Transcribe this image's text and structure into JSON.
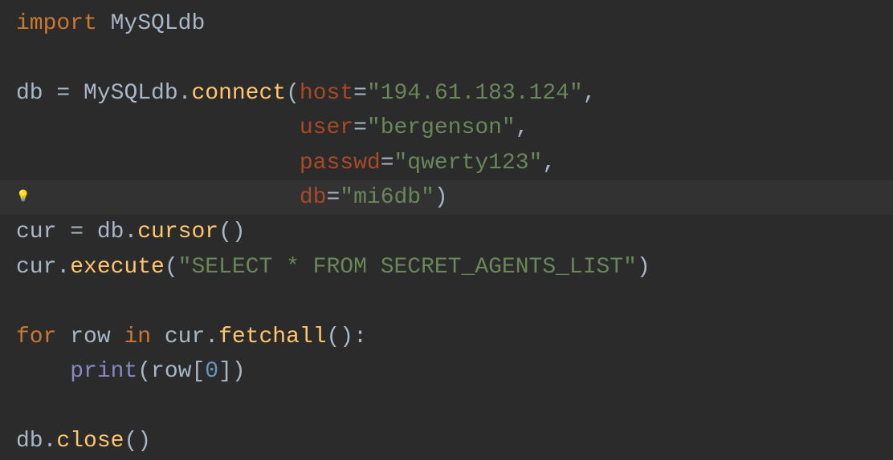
{
  "code": {
    "line1": {
      "import_kw": "import",
      "module": " MySQLdb"
    },
    "line3": {
      "var": "db ",
      "eq": "=",
      "module": " MySQLdb.",
      "method": "connect",
      "paren_open": "(",
      "param": "host",
      "param_eq": "=",
      "string": "\"194.61.183.124\"",
      "comma": ","
    },
    "line4": {
      "indent": "                     ",
      "param": "user",
      "param_eq": "=",
      "string": "\"bergenson\"",
      "comma": ","
    },
    "line5": {
      "indent": "                     ",
      "param": "passwd",
      "param_eq": "=",
      "string": "\"qwerty123\"",
      "comma": ","
    },
    "line6": {
      "indent": "                     ",
      "param": "db",
      "param_eq": "=",
      "string": "\"mi6db\"",
      "paren_close": ")"
    },
    "line7": {
      "var": "cur ",
      "eq": "=",
      "obj": " db.",
      "method": "cursor",
      "parens": "()"
    },
    "line8": {
      "obj": "cur.",
      "method": "execute",
      "paren_open": "(",
      "string": "\"SELECT * FROM SECRET_AGENTS_LIST\"",
      "paren_close": ")"
    },
    "line10": {
      "for_kw": "for ",
      "var": "row ",
      "in_kw": "in ",
      "obj": "cur.",
      "method": "fetchall",
      "parens": "():"
    },
    "line11": {
      "indent": "    ",
      "builtin": "print",
      "paren_open": "(",
      "var": "row[",
      "number": "0",
      "close": "])"
    },
    "line13": {
      "obj": "db.",
      "method": "close",
      "parens": "()"
    }
  },
  "icons": {
    "bulb": "💡"
  }
}
